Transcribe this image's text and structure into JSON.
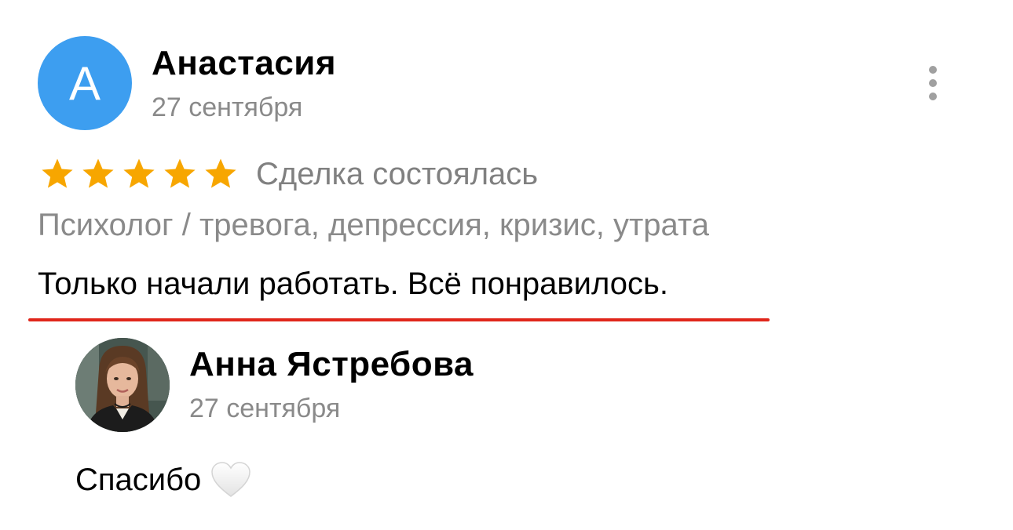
{
  "review": {
    "author": {
      "avatar_letter": "А",
      "name": "Анастасия",
      "date": "27 сентября",
      "avatar_color": "#3d9ef0"
    },
    "more_icon": "more-vertical-icon",
    "rating": {
      "stars": 5,
      "max_stars": 5,
      "star_color": "#f7a600",
      "deal_status": "Сделка состоялась"
    },
    "service": "Психолог / тревога, депрессия, кризис, утрата",
    "text": "Только начали работать. Всё понравилось.",
    "highlight_color": "#e0261b"
  },
  "reply": {
    "author": {
      "name": "Анна Ястребова",
      "date": "27 сентября"
    },
    "text": "Спасибо",
    "emoji_icon": "white-heart-icon"
  }
}
